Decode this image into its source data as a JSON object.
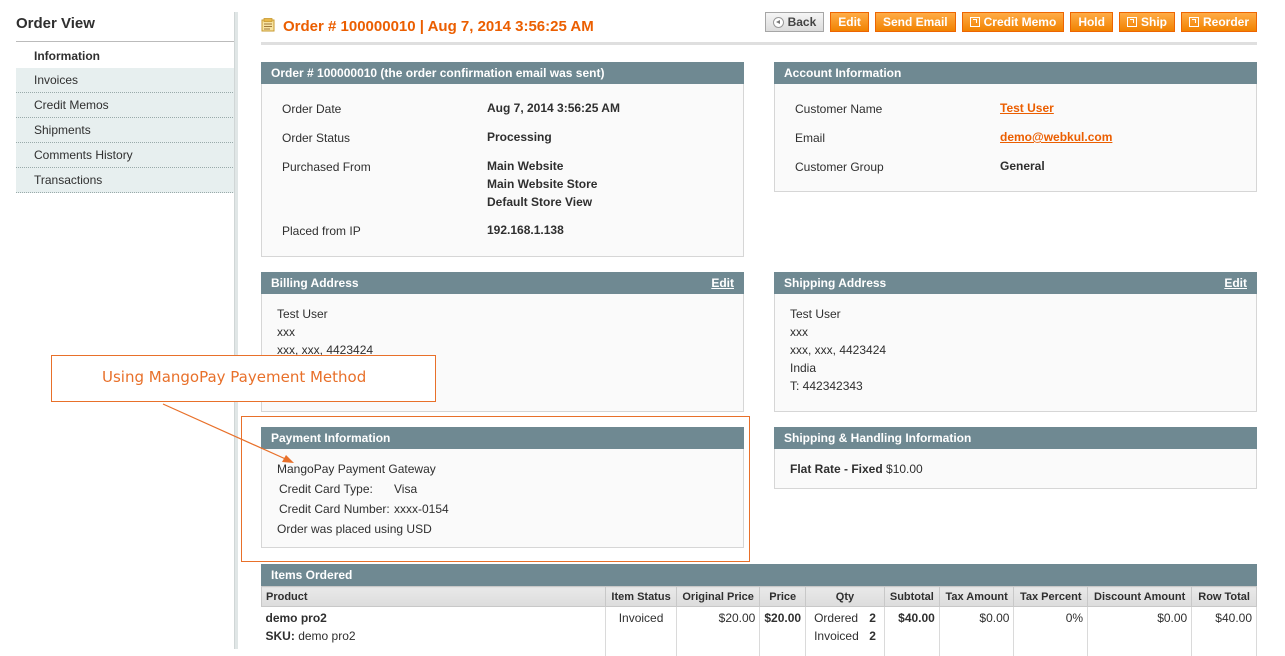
{
  "sidebar": {
    "title": "Order View",
    "tabs": [
      "Information",
      "Invoices",
      "Credit Memos",
      "Shipments",
      "Comments History",
      "Transactions"
    ]
  },
  "header": {
    "title": "Order # 100000010 | Aug 7, 2014 3:56:25 AM",
    "buttons": {
      "back": "Back",
      "edit": "Edit",
      "send_email": "Send Email",
      "credit_memo": "Credit Memo",
      "hold": "Hold",
      "ship": "Ship",
      "reorder": "Reorder"
    }
  },
  "order": {
    "heading": "Order # 100000010 (the order confirmation email was sent)",
    "date_label": "Order Date",
    "date": "Aug 7, 2014 3:56:25 AM",
    "status_label": "Order Status",
    "status": "Processing",
    "purchased_label": "Purchased From",
    "purchased_lines": [
      "Main Website",
      "Main Website Store",
      "Default Store View"
    ],
    "ip_label": "Placed from IP",
    "ip": "192.168.1.138"
  },
  "account": {
    "heading": "Account Information",
    "name_label": "Customer Name",
    "name": "Test User",
    "email_label": "Email",
    "email": "demo@webkul.com",
    "group_label": "Customer Group",
    "group": "General"
  },
  "billing": {
    "heading": "Billing Address",
    "edit": "Edit",
    "lines": [
      "Test User",
      "xxx",
      "xxx, xxx, 4423424"
    ]
  },
  "shipping": {
    "heading": "Shipping Address",
    "edit": "Edit",
    "lines": [
      "Test User",
      "xxx",
      "xxx, xxx, 4423424",
      "India",
      "T: 442342343"
    ]
  },
  "payment": {
    "heading": "Payment Information",
    "method": "MangoPay Payment Gateway",
    "card_type_label": "Credit Card Type:",
    "card_type": "Visa",
    "card_number_label": "Credit Card Number:",
    "card_number": "xxxx-0154",
    "currency_note": "Order was placed using USD"
  },
  "shipping_handling": {
    "heading": "Shipping & Handling Information",
    "method": "Flat Rate - Fixed",
    "amount": "$10.00"
  },
  "annotation": {
    "text": "Using MangoPay Payement Method",
    "color": "#e8702a"
  },
  "items": {
    "heading": "Items Ordered",
    "columns": [
      "Product",
      "Item Status",
      "Original Price",
      "Price",
      "Qty",
      "Subtotal",
      "Tax Amount",
      "Tax Percent",
      "Discount Amount",
      "Row Total"
    ],
    "rows": [
      {
        "name": "demo pro2",
        "sku_label": "SKU:",
        "sku": "demo pro2",
        "status": "Invoiced",
        "original_price": "$20.00",
        "price": "$20.00",
        "qty_ordered_label": "Ordered",
        "qty_ordered": "2",
        "qty_invoiced_label": "Invoiced",
        "qty_invoiced": "2",
        "subtotal": "$40.00",
        "tax_amount": "$0.00",
        "tax_percent": "0%",
        "discount": "$0.00",
        "row_total": "$40.00"
      }
    ]
  },
  "colors": {
    "accent": "#eb5e00",
    "panel_header": "#6f8992",
    "button": "#f18200"
  }
}
